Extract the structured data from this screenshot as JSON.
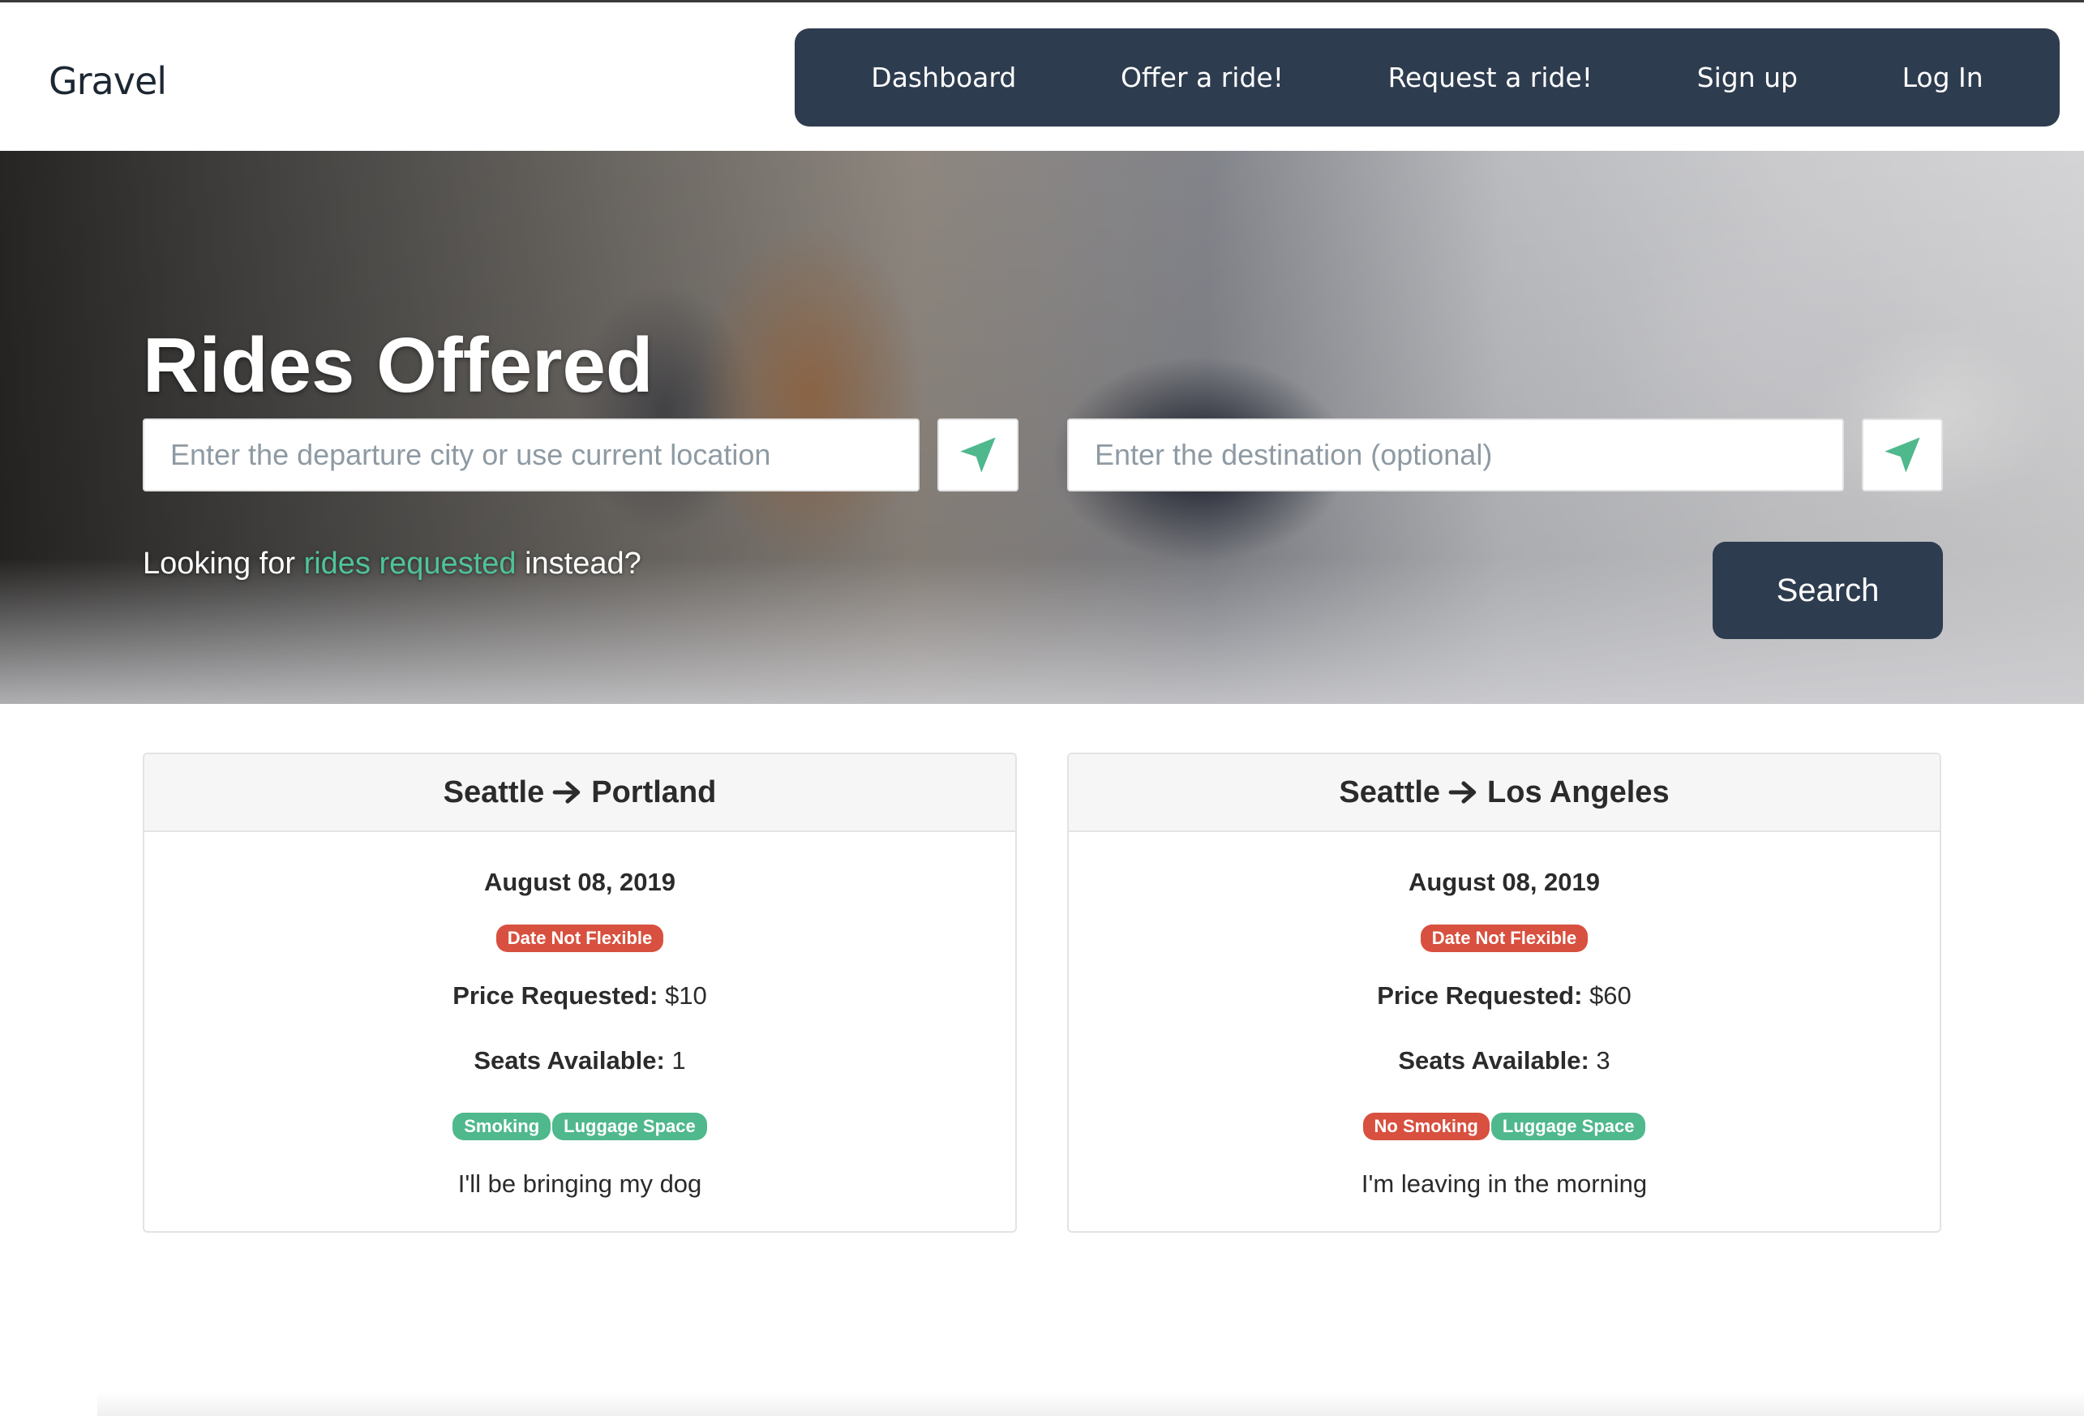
{
  "brand": {
    "name": "Gravel"
  },
  "nav": {
    "items": [
      {
        "label": "Dashboard"
      },
      {
        "label": "Offer a ride!"
      },
      {
        "label": "Request a ride!"
      },
      {
        "label": "Sign up"
      },
      {
        "label": "Log In"
      }
    ]
  },
  "hero": {
    "title": "Rides Offered",
    "departure_placeholder": "Enter the departure city or use current location",
    "destination_placeholder": "Enter the destination (optional)",
    "alt_prefix": "Looking for ",
    "alt_link": "rides requested",
    "alt_suffix": " instead?",
    "search_label": "Search",
    "location_icon": "location-arrow-icon"
  },
  "rides": [
    {
      "from": "Seattle",
      "to": "Portland",
      "date": "August 08, 2019",
      "flex_badge": "Date Not Flexible",
      "price_label": "Price Requested:",
      "price_value": " $10",
      "seats_label": "Seats Available:",
      "seats_value": " 1",
      "features": [
        {
          "label": "Smoking",
          "color": "#4fb88d"
        },
        {
          "label": "Luggage Space",
          "color": "#4fb88d"
        }
      ],
      "note": "I'll be bringing my dog"
    },
    {
      "from": "Seattle",
      "to": "Los Angeles",
      "date": "August 08, 2019",
      "flex_badge": "Date Not Flexible",
      "price_label": "Price Requested:",
      "price_value": " $60",
      "seats_label": "Seats Available:",
      "seats_value": " 3",
      "features": [
        {
          "label": "No Smoking",
          "color": "#d8503f"
        },
        {
          "label": "Luggage Space",
          "color": "#4fb88d"
        }
      ],
      "note": "I'm leaving in the morning"
    }
  ],
  "colors": {
    "nav_bg": "#2e3c4f",
    "accent_green": "#4fb88d",
    "badge_red": "#d8503f",
    "link_green": "#4fc39a"
  }
}
